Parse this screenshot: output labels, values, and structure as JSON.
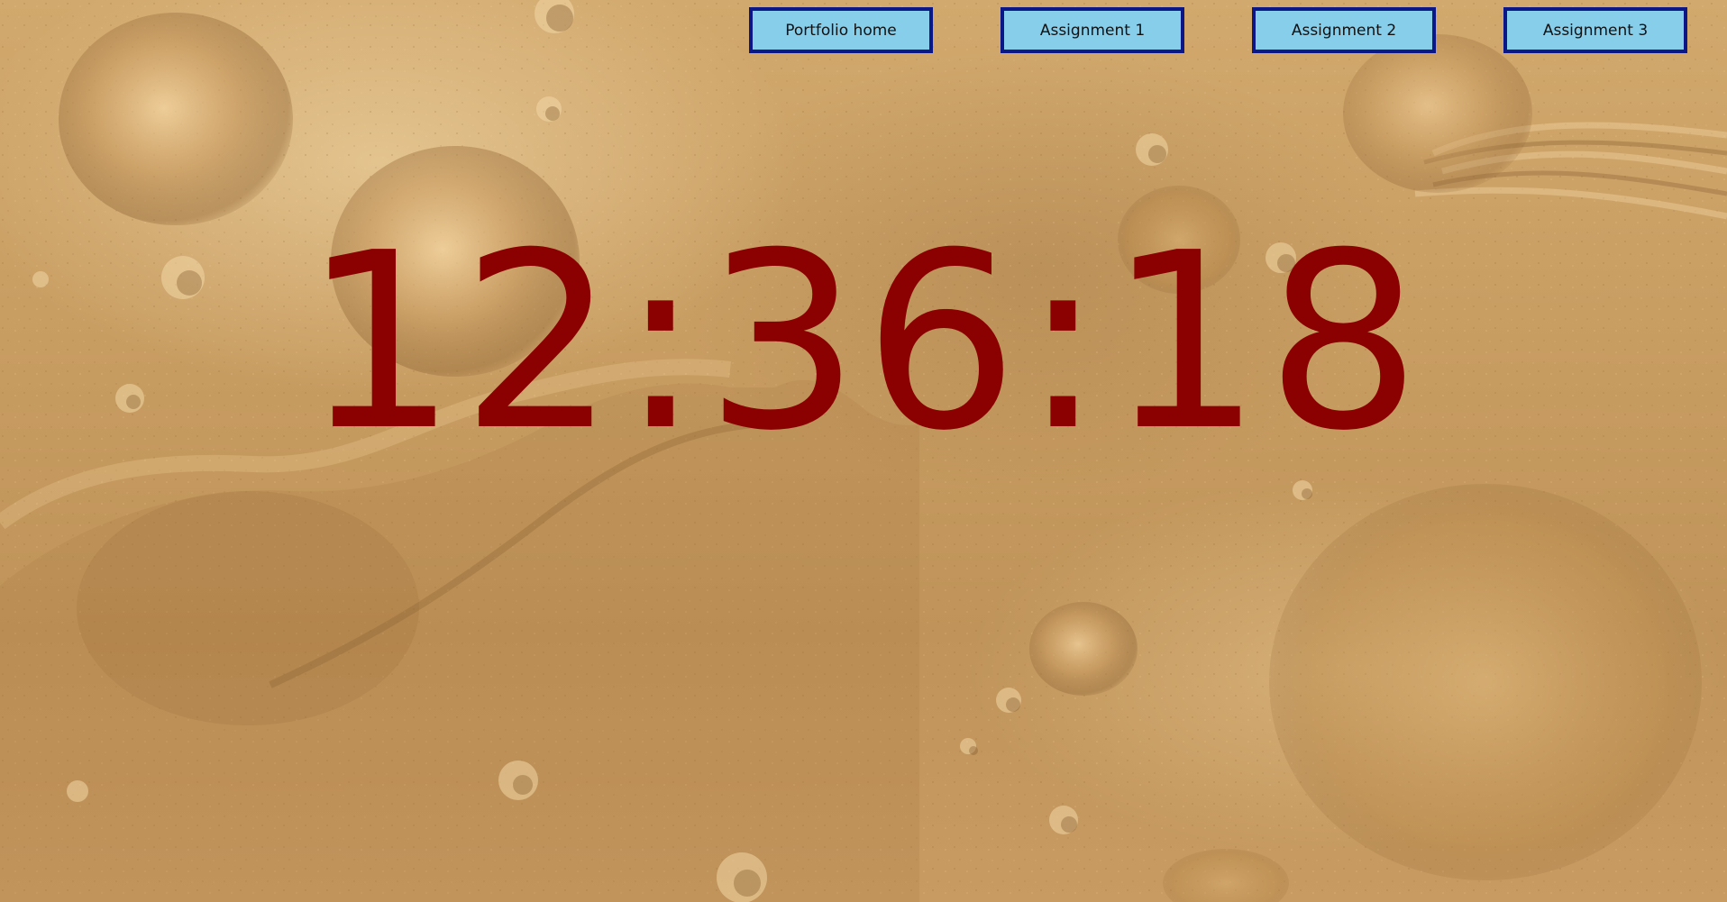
{
  "nav": {
    "items": [
      {
        "label": "Portfolio home"
      },
      {
        "label": "Assignment 1"
      },
      {
        "label": "Assignment 2"
      },
      {
        "label": "Assignment 3"
      }
    ]
  },
  "clock": {
    "time": "12:36:18"
  },
  "colors": {
    "clock_text": "#8b0000",
    "nav_background": "#87ceeb",
    "nav_border": "#0b1786",
    "page_background": "#c49a5f"
  }
}
